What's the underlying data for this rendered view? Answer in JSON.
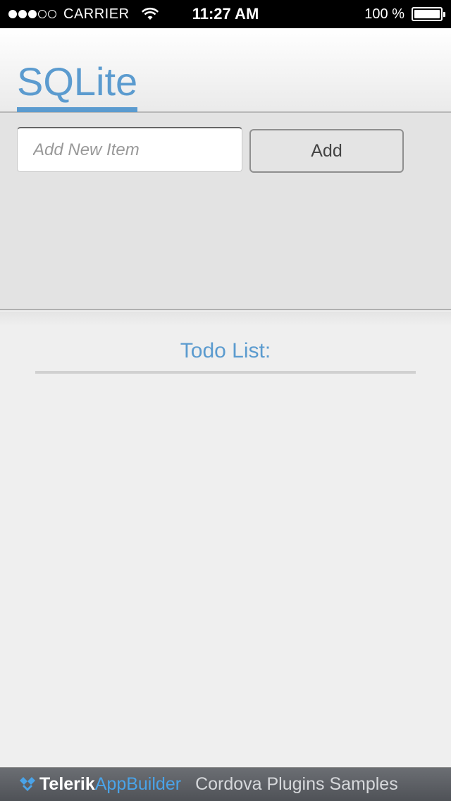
{
  "status_bar": {
    "signal_dots_filled": 3,
    "signal_dots_total": 5,
    "carrier": "CARRIER",
    "time": "11:27 AM",
    "battery_text": "100 %",
    "battery_level": 1.0
  },
  "header": {
    "title": "SQLite"
  },
  "form": {
    "input_placeholder": "Add New Item",
    "input_value": "",
    "add_button_label": "Add"
  },
  "todo": {
    "heading": "Todo List:",
    "items": []
  },
  "footer": {
    "brand_part1": "Telerik",
    "brand_part2": "AppBuilder",
    "text": "Cordova Plugins Samples"
  },
  "colors": {
    "accent": "#5b9bcf",
    "panel": "#e3e3e3",
    "background": "#efefef",
    "footer": "#5d6065"
  }
}
